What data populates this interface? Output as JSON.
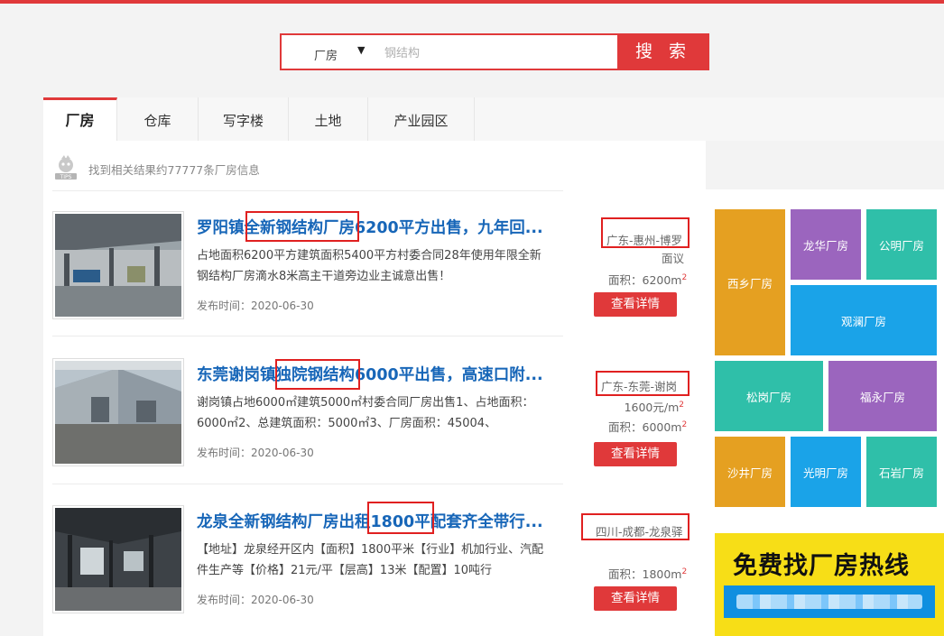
{
  "search": {
    "type_label": "厂房",
    "placeholder": "钢结构",
    "button_label": "搜 索"
  },
  "tabs": [
    {
      "label": "厂房",
      "active": true
    },
    {
      "label": "仓库",
      "active": false
    },
    {
      "label": "写字楼",
      "active": false
    },
    {
      "label": "土地",
      "active": false
    },
    {
      "label": "产业园区",
      "active": false
    }
  ],
  "tips": {
    "icon_label": "TIPS",
    "text": "找到相关结果约77777条厂房信息"
  },
  "listings": [
    {
      "title": "罗阳镇全新钢结构厂房6200平方出售，九年回...",
      "desc": "占地面积6200平方建筑面积5400平方村委合同28年使用年限全新钢结构厂房滴水8米高主干道旁边业主诚意出售！",
      "date": "发布时间：2020-06-30",
      "location": "广东-惠州-博罗",
      "price": "面议",
      "area": "面积：6200m",
      "area_unit_sup": "2",
      "detail_label": "查看详情"
    },
    {
      "title": "东莞谢岗镇独院钢结构6000平出售，高速口附...",
      "desc": "谢岗镇占地6000㎡建筑5000㎡村委合同厂房出售1、占地面积：6000㎡2、总建筑面积：5000㎡3、厂房面积：45004、",
      "date": "发布时间：2020-06-30",
      "location": "广东-东莞-谢岗",
      "price": "1600元/m",
      "price_unit_sup": "2",
      "area": "面积：6000m",
      "area_unit_sup": "2",
      "detail_label": "查看详情"
    },
    {
      "title": "龙泉全新钢结构厂房出租1800平配套齐全带行...",
      "desc": "【地址】龙泉经开区内【面积】1800平米【行业】机加行业、汽配件生产等【价格】21元/平【层高】13米【配置】10吨行",
      "date": "发布时间：2020-06-30",
      "location": "四川-成都-龙泉驿",
      "area": "面积：1800m",
      "area_unit_sup": "2",
      "detail_label": "查看详情"
    }
  ],
  "district_tiles": [
    {
      "label": "西乡厂房",
      "color": "#e5a021"
    },
    {
      "label": "龙华厂房",
      "color": "#9b65be"
    },
    {
      "label": "公明厂房",
      "color": "#2fbfa9"
    },
    {
      "label": "观澜厂房",
      "color": "#1aa3e8"
    },
    {
      "label": "松岗厂房",
      "color": "#2fbfa9"
    },
    {
      "label": "福永厂房",
      "color": "#9b65be"
    },
    {
      "label": "沙井厂房",
      "color": "#e5a021"
    },
    {
      "label": "光明厂房",
      "color": "#1aa3e8"
    },
    {
      "label": "石岩厂房",
      "color": "#2fbfa9"
    }
  ],
  "banner": {
    "title": "免费找厂房热线"
  },
  "colors": {
    "accent": "#e0393a",
    "link": "#1766b8",
    "highlight_box": "#e02020"
  }
}
